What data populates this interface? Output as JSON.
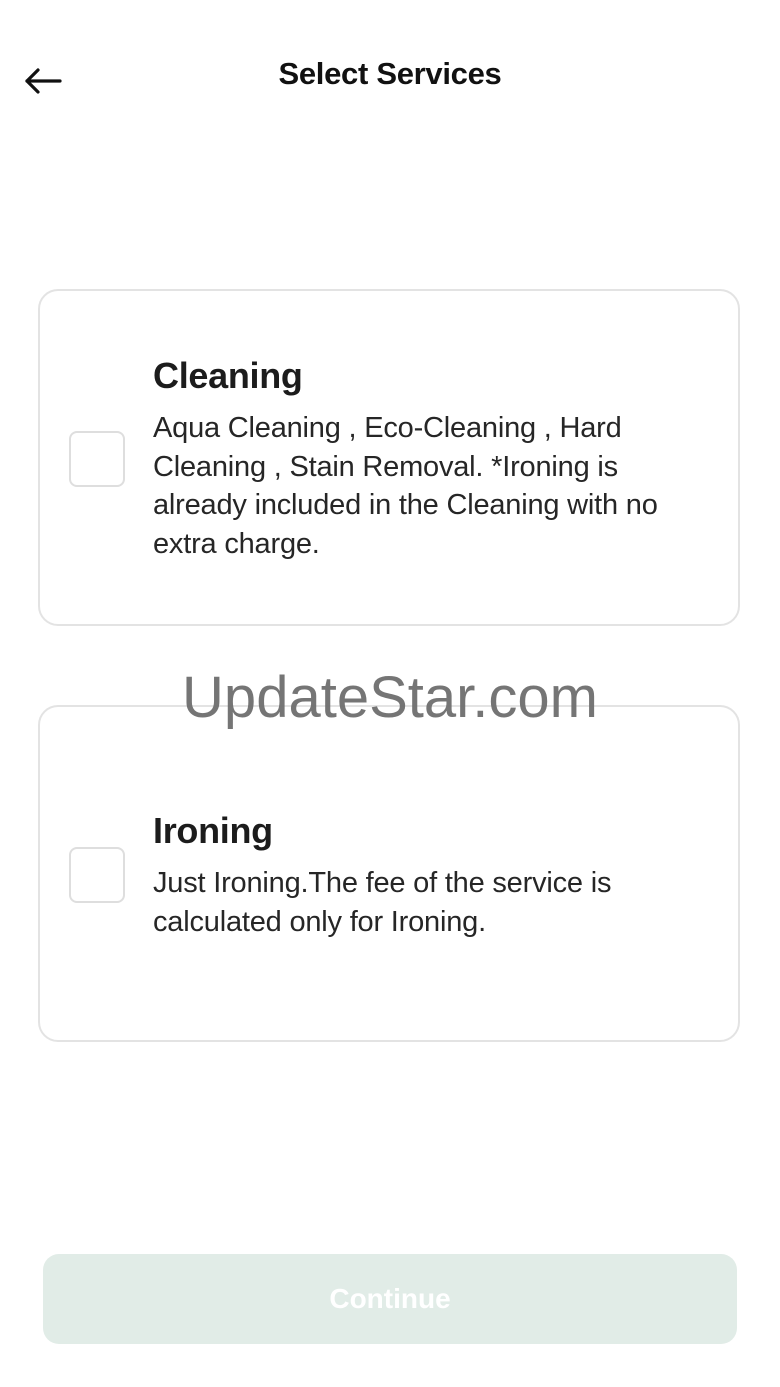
{
  "header": {
    "title": "Select Services",
    "back_icon": "arrow-left-icon"
  },
  "services": [
    {
      "title": "Cleaning",
      "description": "Aqua Cleaning , Eco-Cleaning , Hard Cleaning , Stain Removal. *Ironing is already included in the Cleaning with no extra charge.",
      "checked": false
    },
    {
      "title": "Ironing",
      "description": "Just Ironing.The fee of the service is calculated only for Ironing.",
      "checked": false
    }
  ],
  "watermark": "UpdateStar.com",
  "footer": {
    "continue_label": "Continue",
    "continue_enabled": false
  },
  "colors": {
    "continue_disabled_bg": "#e1ece7",
    "card_border": "#e3e3e3",
    "checkbox_border": "#dedede"
  }
}
